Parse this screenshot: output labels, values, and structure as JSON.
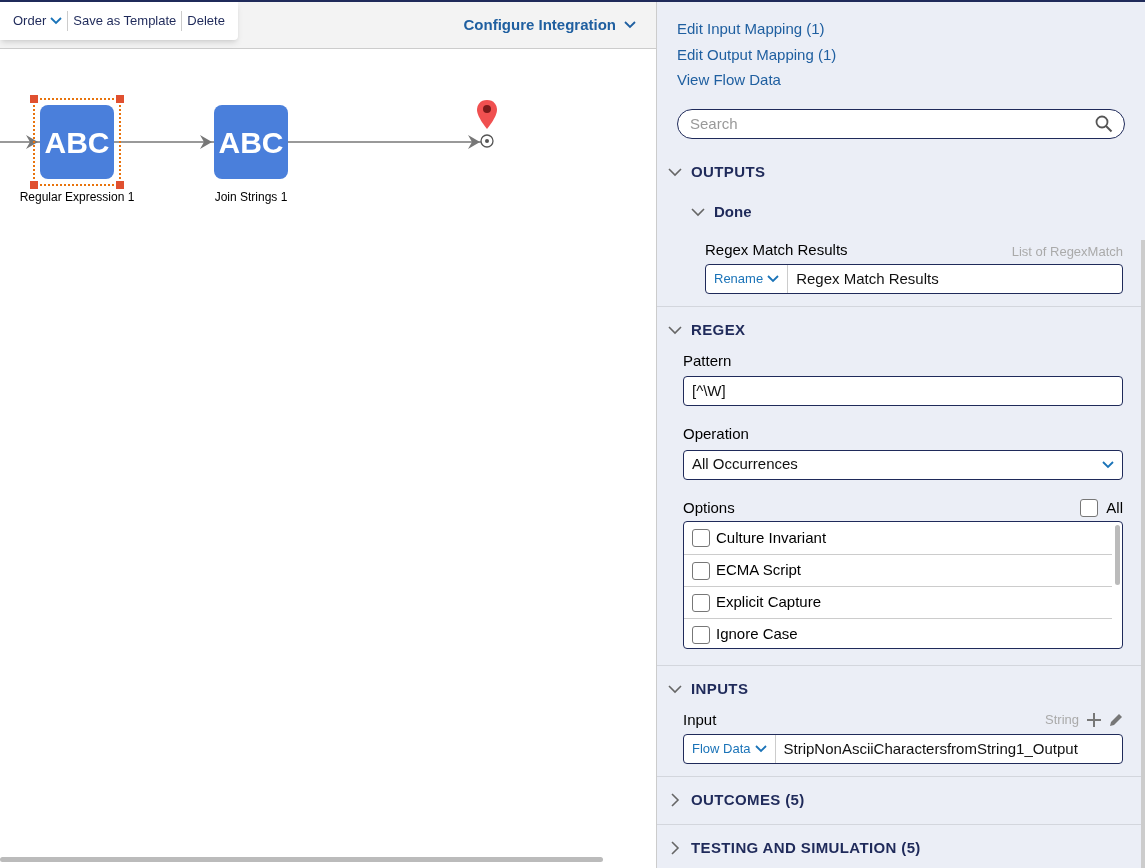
{
  "toolbar": {
    "items": [
      {
        "label": "Order",
        "kind": "dropdown"
      },
      {
        "label": "Save as Template",
        "kind": "button"
      },
      {
        "label": "Delete",
        "kind": "button"
      }
    ]
  },
  "header": {
    "title": "Configure Integration"
  },
  "canvas": {
    "nodes": [
      {
        "icon_text": "ABC",
        "label": "Regular Expression 1",
        "selected": true
      },
      {
        "icon_text": "ABC",
        "label": "Join Strings 1",
        "selected": false
      }
    ]
  },
  "panel": {
    "links": [
      "Edit Input Mapping (1)",
      "Edit Output Mapping (1)",
      "View Flow Data"
    ],
    "search": {
      "placeholder": "Search"
    },
    "outputs": {
      "title": "OUTPUTS",
      "expanded": true,
      "group": {
        "title": "Done",
        "expanded": true,
        "field": {
          "label": "Regex Match Results",
          "type": "List of RegexMatch",
          "mode": "Rename",
          "value": "Regex Match Results"
        }
      }
    },
    "regex": {
      "title": "REGEX",
      "expanded": true,
      "pattern": {
        "label": "Pattern",
        "value": "[^\\W]"
      },
      "operation": {
        "label": "Operation",
        "value": "All Occurrences"
      },
      "options": {
        "label": "Options",
        "all": {
          "label": "All",
          "checked": false
        },
        "items": [
          {
            "label": "Culture Invariant",
            "checked": false
          },
          {
            "label": "ECMA Script",
            "checked": false
          },
          {
            "label": "Explicit Capture",
            "checked": false
          },
          {
            "label": "Ignore Case",
            "checked": false
          }
        ]
      }
    },
    "inputs": {
      "title": "INPUTS",
      "expanded": true,
      "field": {
        "label": "Input",
        "type": "String",
        "mode": "Flow Data",
        "value": "StripNonAsciiCharactersfromString1_Output"
      }
    },
    "collapsed": [
      {
        "title": "OUTCOMES (5)",
        "expanded": false
      },
      {
        "title": "TESTING AND SIMULATION (5)",
        "expanded": false
      }
    ]
  }
}
